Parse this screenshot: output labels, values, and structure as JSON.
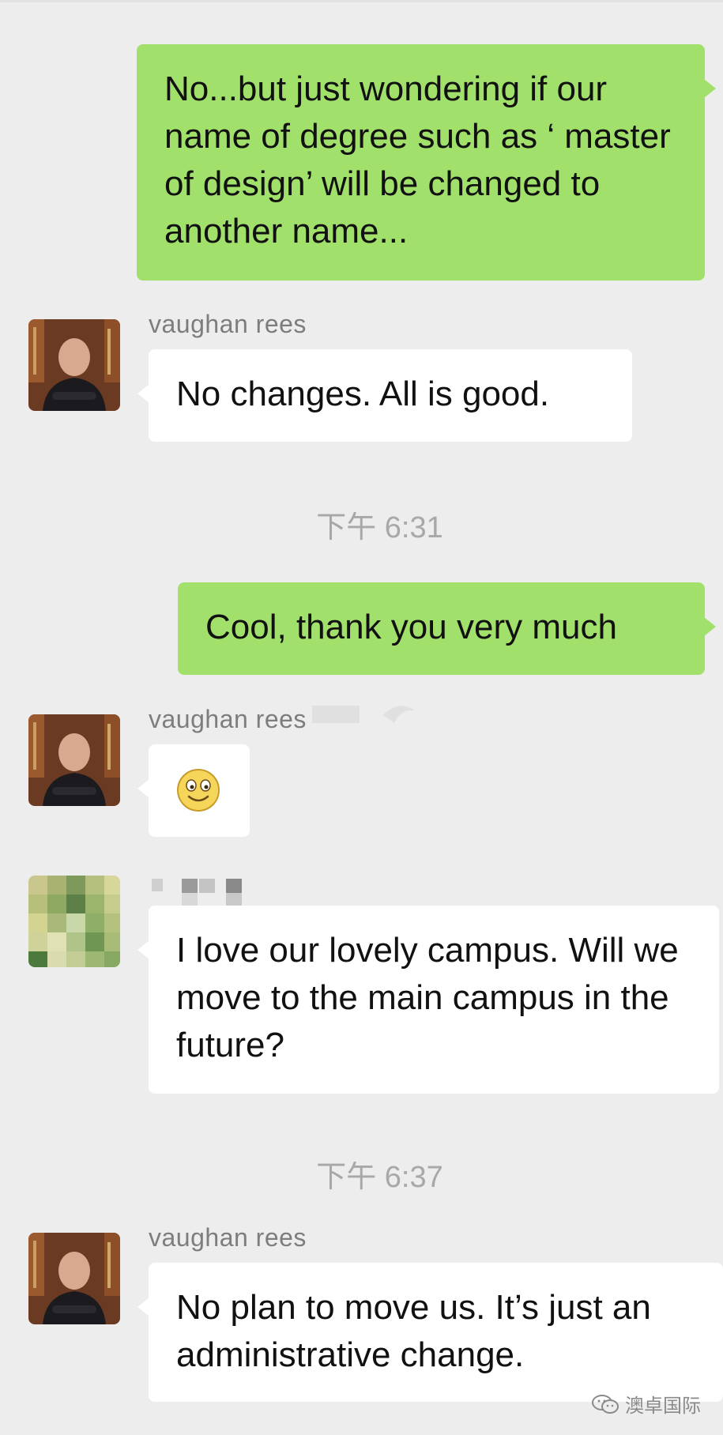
{
  "messages": [
    {
      "text": "No...but just wondering if our name of degree such as ‘ master of design’ will be changed to another name..."
    },
    {
      "sender": "vaughan rees",
      "text": "No changes. All is good."
    },
    {
      "time": "下午 6:31"
    },
    {
      "text": "Cool, thank you very much"
    },
    {
      "sender": "vaughan rees",
      "emoji": "smile-emoji"
    },
    {
      "text": "I love our lovely campus. Will we move to the main campus in the future?"
    },
    {
      "time": "下午 6:37"
    },
    {
      "sender": "vaughan rees",
      "text": "No plan to move us. It’s just an administrative change."
    }
  ],
  "watermark": {
    "text": "澳卓国际",
    "icon": "wechat-icon"
  },
  "colors": {
    "background": "#ededed",
    "sent_bubble": "#a2e06c",
    "received_bubble": "#ffffff"
  }
}
